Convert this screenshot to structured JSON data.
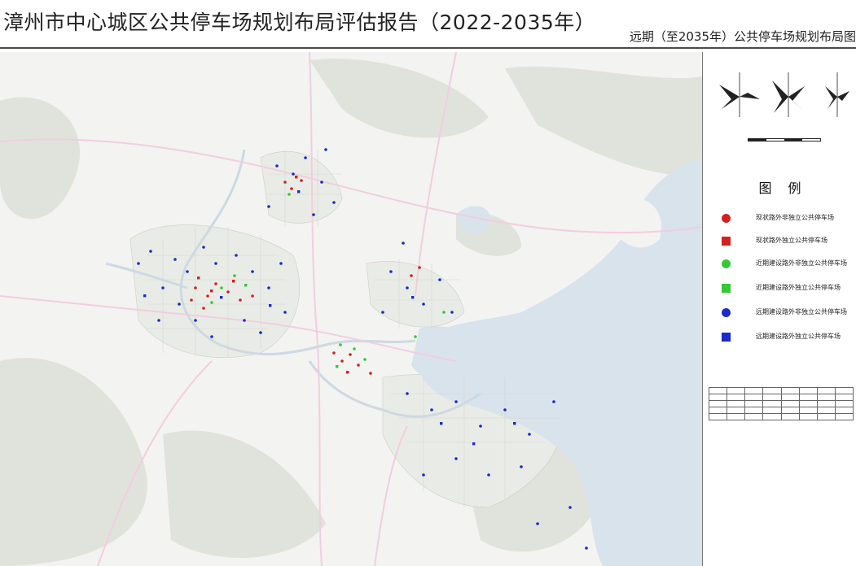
{
  "header": {
    "title": "漳州市中心城区公共停车场规划布局评估报告（2022-2035年）",
    "subtitle": "远期（至2035年）公共停车场规划布局图"
  },
  "legend": {
    "title": "图例",
    "items": [
      {
        "label": "现状路外非独立公共停车场",
        "shape": "circle",
        "color": "#d42020"
      },
      {
        "label": "现状路外独立公共停车场",
        "shape": "square",
        "color": "#d42020"
      },
      {
        "label": "近期建设路外非独立公共停车场",
        "shape": "circle",
        "color": "#34c934"
      },
      {
        "label": "近期建设路外独立公共停车场",
        "shape": "square",
        "color": "#34c934"
      },
      {
        "label": "远期建设路外非独立公共停车场",
        "shape": "circle",
        "color": "#1a2bc8"
      },
      {
        "label": "远期建设路外独立公共停车场",
        "shape": "square",
        "color": "#1a2bc8"
      }
    ]
  },
  "colors": {
    "water": "#d8e3ec",
    "land": "#f3f3f1",
    "hills": "#dfe3db",
    "urban": "#e9ece6",
    "road": "#f6d9ea",
    "red": "#d42020",
    "green": "#34c934",
    "blue": "#1a2bc8"
  }
}
